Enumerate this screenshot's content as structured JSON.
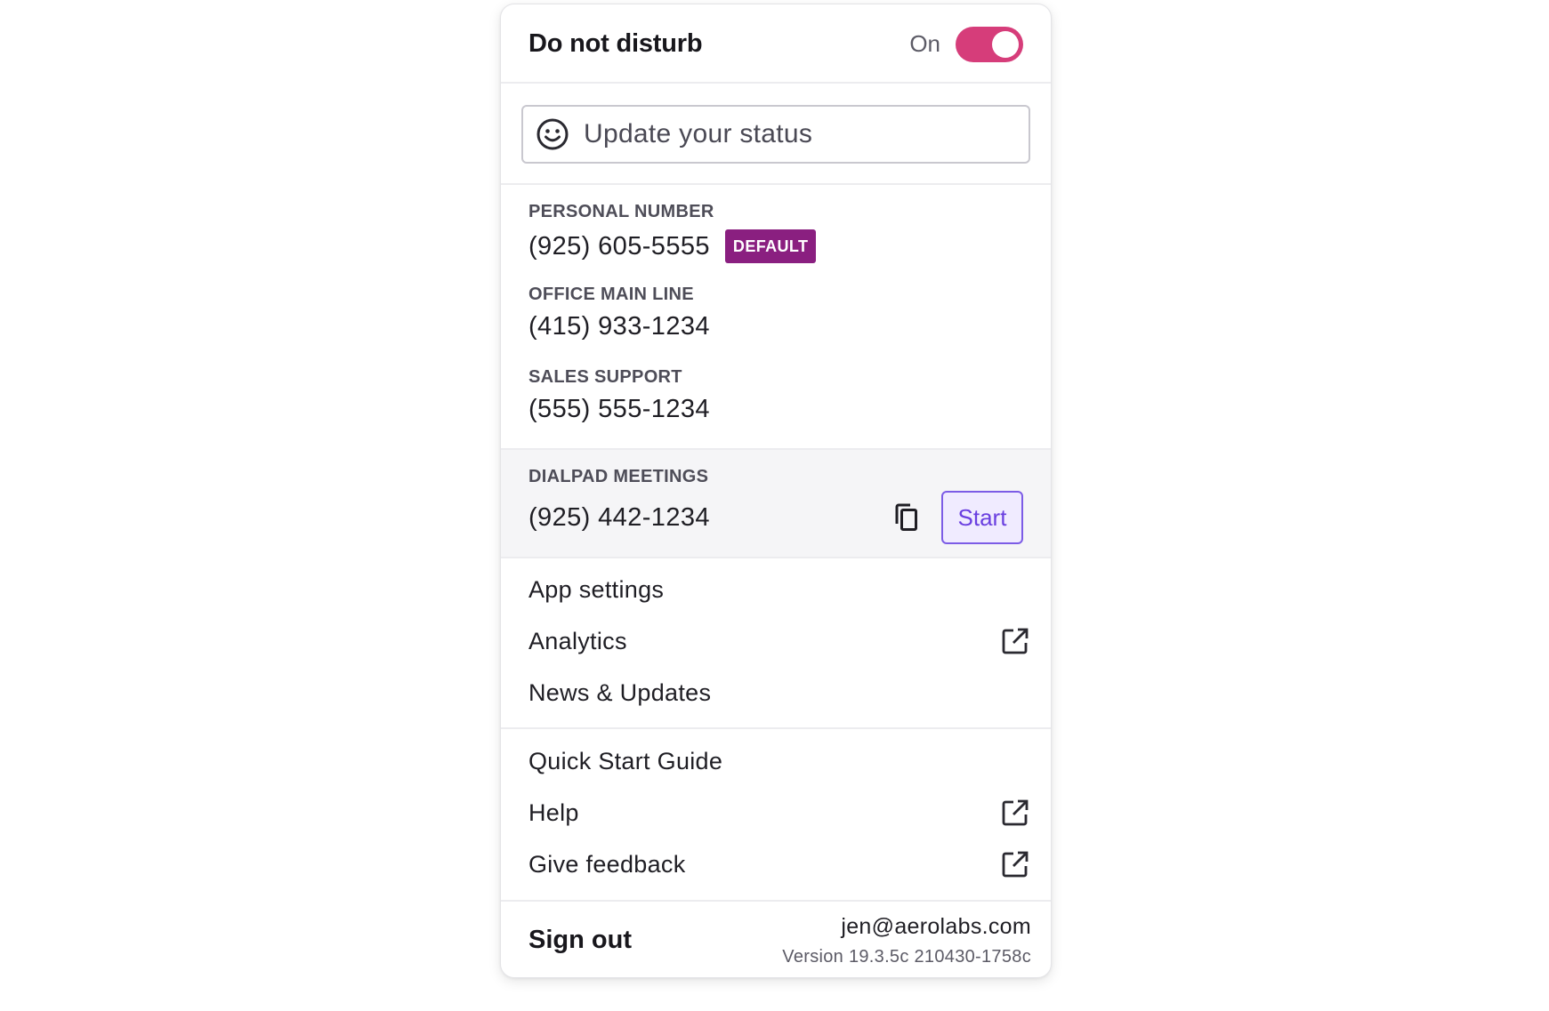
{
  "dnd": {
    "title": "Do not disturb",
    "state_label": "On",
    "enabled": true,
    "toggle_color": "#d63d7a"
  },
  "status": {
    "placeholder": "Update your status",
    "icon": "smile-icon"
  },
  "numbers": [
    {
      "label": "PERSONAL NUMBER",
      "value": "(925) 605-5555",
      "badge": "DEFAULT"
    },
    {
      "label": "OFFICE MAIN LINE",
      "value": "(415) 933-1234"
    },
    {
      "label": "SALES SUPPORT",
      "value": "(555) 555-1234"
    }
  ],
  "meetings": {
    "label": "DIALPAD MEETINGS",
    "value": "(925) 442-1234",
    "start_label": "Start",
    "copy_icon": "copy-icon"
  },
  "menu1": [
    {
      "label": "App settings",
      "external": false
    },
    {
      "label": "Analytics",
      "external": true
    },
    {
      "label": "News & Updates",
      "external": false
    }
  ],
  "menu2": [
    {
      "label": "Quick Start Guide",
      "external": false
    },
    {
      "label": "Help",
      "external": true
    },
    {
      "label": "Give feedback",
      "external": true
    }
  ],
  "footer": {
    "signout": "Sign out",
    "email": "jen@aerolabs.com",
    "version": "Version 19.3.5c 210430-1758c"
  },
  "colors": {
    "badge": "#8a1f80",
    "accent": "#7c5ce6"
  }
}
